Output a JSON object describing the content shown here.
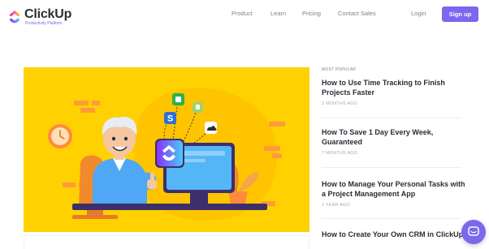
{
  "brand": {
    "name": "ClickUp",
    "tagline": "Productivity Platform",
    "colors": {
      "primary": "#7b68ee",
      "pink": "#fd71af",
      "blue": "#49ccf9",
      "yellow": "#ffd100"
    }
  },
  "nav": {
    "product": "Product",
    "learn": "Learn",
    "pricing": "Pricing",
    "contact": "Contact Sales",
    "login": "Login",
    "signup": "Sign up"
  },
  "hero": {
    "icon": "clickup-illustration"
  },
  "sidebar": {
    "heading": "MOST POPULAR",
    "posts": [
      {
        "title": "How to Use Time Tracking to Finish Projects Faster",
        "date": "2 MONTHS AGO"
      },
      {
        "title": "How To Save 1 Day Every Week, Guaranteed",
        "date": "7 MONTHS AGO"
      },
      {
        "title": "How to Manage Your Personal Tasks with a Project Management App",
        "date": "1 YEAR AGO"
      },
      {
        "title": "How to Create Your Own CRM in ClickUp",
        "date": ""
      }
    ]
  },
  "chat": {
    "icon": "chat-icon"
  }
}
